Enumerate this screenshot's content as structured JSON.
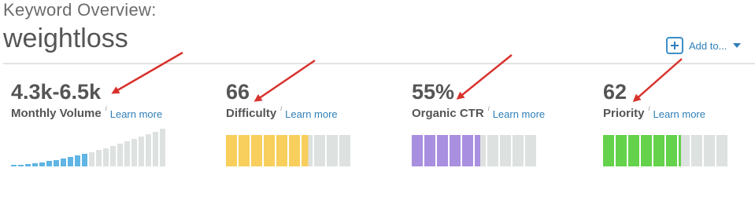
{
  "header": {
    "label": "Keyword Overview:",
    "keyword": "weightloss"
  },
  "add_to": {
    "label": "Add to...",
    "icon": "plus-icon"
  },
  "metrics": [
    {
      "value": "4.3k-6.5k",
      "label": "Monthly Volume",
      "info": "i",
      "learn_more": "Learn more"
    },
    {
      "value": "66",
      "label": "Difficulty",
      "info": "i",
      "learn_more": "Learn more"
    },
    {
      "value": "55%",
      "label": "Organic CTR",
      "info": "i",
      "learn_more": "Learn more"
    },
    {
      "value": "62",
      "label": "Priority",
      "info": "i",
      "learn_more": "Learn more"
    }
  ],
  "meters": {
    "volume": {
      "total_bars": 22,
      "filled_bars": 11,
      "fill_color": "#5fb5e4",
      "empty_color": "#dde1e0"
    },
    "difficulty": {
      "total_segments": 10,
      "filled_segments": 6.6,
      "fill_color": "#f8cf5c",
      "empty_color": "#dde1e0"
    },
    "organic_ctr": {
      "total_segments": 10,
      "filled_segments": 5.5,
      "fill_color": "#a98fdf",
      "empty_color": "#dde1e0"
    },
    "priority": {
      "total_segments": 10,
      "filled_segments": 6.2,
      "fill_color": "#64d24a",
      "empty_color": "#dde1e0"
    }
  },
  "annotation_color": "#d8322d"
}
